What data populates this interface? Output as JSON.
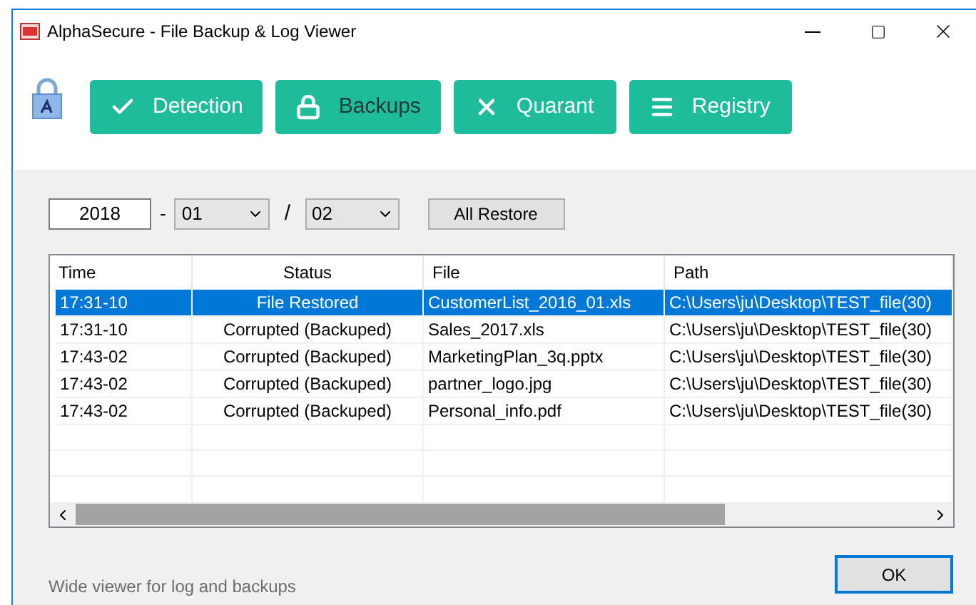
{
  "window": {
    "title": "AlphaSecure - File Backup & Log Viewer"
  },
  "tabs": [
    {
      "label": "Detection",
      "kind": "check",
      "selected": false
    },
    {
      "label": "Backups",
      "kind": "lock",
      "selected": true
    },
    {
      "label": "Quarant",
      "kind": "x",
      "selected": false
    },
    {
      "label": "Registry",
      "kind": "menu",
      "selected": false
    }
  ],
  "filter": {
    "year": "2018",
    "separator_1": "-",
    "month": "01",
    "separator_2": "/",
    "day": "02",
    "restore_button": "All Restore"
  },
  "table": {
    "columns": [
      "Time",
      "Status",
      "File",
      "Path"
    ],
    "rows": [
      {
        "cells": [
          "17:31-10",
          "File Restored",
          "CustomerList_2016_01.xls",
          "C:\\Users\\ju\\Desktop\\TEST_file(30)"
        ],
        "selected": true
      },
      {
        "cells": [
          "17:31-10",
          "Corrupted (Backuped)",
          "Sales_2017.xls",
          "C:\\Users\\ju\\Desktop\\TEST_file(30)"
        ],
        "selected": false
      },
      {
        "cells": [
          "17:43-02",
          "Corrupted (Backuped)",
          "MarketingPlan_3q.pptx",
          "C:\\Users\\ju\\Desktop\\TEST_file(30)"
        ],
        "selected": false
      },
      {
        "cells": [
          "17:43-02",
          "Corrupted (Backuped)",
          "partner_logo.jpg",
          "C:\\Users\\ju\\Desktop\\TEST_file(30)"
        ],
        "selected": false
      },
      {
        "cells": [
          "17:43-02",
          "Corrupted (Backuped)",
          "Personal_info.pdf",
          "C:\\Users\\ju\\Desktop\\TEST_file(30)"
        ],
        "selected": false
      }
    ]
  },
  "status_text": "Wide viewer for log and backups",
  "ok_button": "OK"
}
